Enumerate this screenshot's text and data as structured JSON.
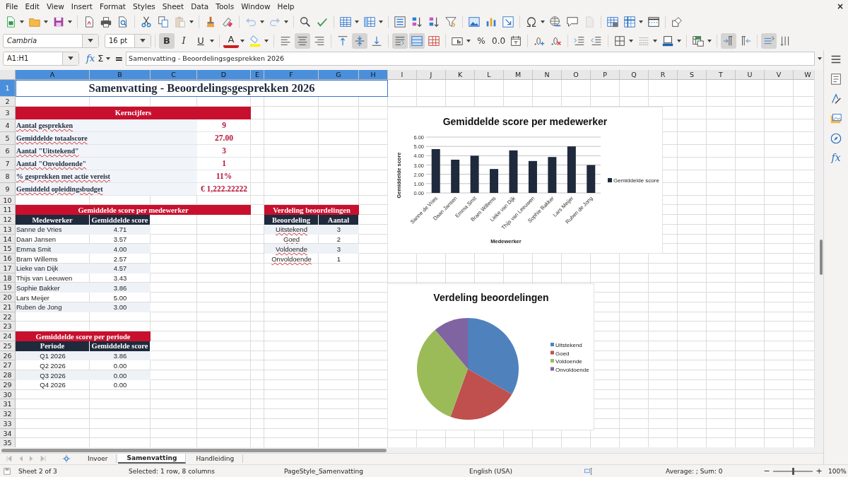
{
  "menu": [
    "File",
    "Edit",
    "View",
    "Insert",
    "Format",
    "Styles",
    "Sheet",
    "Data",
    "Tools",
    "Window",
    "Help"
  ],
  "close_symbol": "×",
  "standard_toolbar": {
    "disabled": {
      "paste": true,
      "undo": true,
      "redo": true,
      "header_footer": true
    }
  },
  "format_toolbar": {
    "font_name": "Cambria",
    "font_size": "16 pt",
    "bold_label": "B",
    "italic_label": "I",
    "underline_label": "U",
    "font_color_label": "A",
    "percent_label": "%",
    "decimal_label": "0.0",
    "toggles": {
      "bold": true,
      "italic": false,
      "underline": false,
      "align_left": false,
      "align_center": true,
      "align_right": false,
      "align_top": false,
      "align_middle": true,
      "align_bottom": false,
      "wrap_text": true,
      "merge_center": true,
      "unmerge": false,
      "left_to_right": true,
      "right_to_left": false,
      "vertical_text": true,
      "stacked": false
    }
  },
  "formula_bar": {
    "name_box": "A1:H1",
    "function_wizard": "fx",
    "sum": "Σ",
    "equals": "=",
    "content": "Samenvatting - Beoordelingsgesprekken 2026"
  },
  "sheet": {
    "column_headers": [
      {
        "label": "A",
        "selected": true
      },
      {
        "label": "B",
        "selected": true
      },
      {
        "label": "C",
        "selected": true
      },
      {
        "label": "D",
        "selected": true
      },
      {
        "label": "E",
        "selected": true
      },
      {
        "label": "F",
        "selected": true
      },
      {
        "label": "G",
        "selected": true
      },
      {
        "label": "H",
        "selected": true
      },
      {
        "label": "I",
        "selected": false
      },
      {
        "label": "J",
        "selected": false
      },
      {
        "label": "K",
        "selected": false
      },
      {
        "label": "L",
        "selected": false
      },
      {
        "label": "M",
        "selected": false
      },
      {
        "label": "N",
        "selected": false
      },
      {
        "label": "O",
        "selected": false
      },
      {
        "label": "P",
        "selected": false
      },
      {
        "label": "Q",
        "selected": false
      },
      {
        "label": "R",
        "selected": false
      },
      {
        "label": "S",
        "selected": false
      },
      {
        "label": "T",
        "selected": false
      },
      {
        "label": "U",
        "selected": false
      },
      {
        "label": "V",
        "selected": false
      },
      {
        "label": "W",
        "selected": false
      }
    ],
    "row_headers": [
      {
        "label": "1",
        "selected": true
      },
      {
        "label": "2",
        "selected": false
      },
      {
        "label": "3",
        "selected": false
      },
      {
        "label": "4",
        "selected": false
      },
      {
        "label": "5",
        "selected": false
      },
      {
        "label": "6",
        "selected": false
      },
      {
        "label": "7",
        "selected": false
      },
      {
        "label": "8",
        "selected": false
      },
      {
        "label": "9",
        "selected": false
      },
      {
        "label": "10",
        "selected": false
      },
      {
        "label": "11",
        "selected": false
      },
      {
        "label": "12",
        "selected": false
      },
      {
        "label": "13",
        "selected": false
      },
      {
        "label": "14",
        "selected": false
      },
      {
        "label": "15",
        "selected": false
      },
      {
        "label": "16",
        "selected": false
      },
      {
        "label": "17",
        "selected": false
      },
      {
        "label": "18",
        "selected": false
      },
      {
        "label": "19",
        "selected": false
      },
      {
        "label": "20",
        "selected": false
      },
      {
        "label": "21",
        "selected": false
      },
      {
        "label": "22",
        "selected": false
      },
      {
        "label": "23",
        "selected": false
      },
      {
        "label": "24",
        "selected": false
      },
      {
        "label": "25",
        "selected": false
      },
      {
        "label": "26",
        "selected": false
      },
      {
        "label": "27",
        "selected": false
      },
      {
        "label": "28",
        "selected": false
      },
      {
        "label": "29",
        "selected": false
      },
      {
        "label": "30",
        "selected": false
      },
      {
        "label": "31",
        "selected": false
      },
      {
        "label": "32",
        "selected": false
      },
      {
        "label": "33",
        "selected": false
      },
      {
        "label": "34",
        "selected": false
      },
      {
        "label": "35",
        "selected": false
      }
    ],
    "title": "Samenvatting - Beoordelingsgesprekken 2026",
    "key_figures": {
      "title": "Kerncijfers",
      "rows": [
        {
          "label": "Aantal gesprekken",
          "value": "9",
          "misspelled": true
        },
        {
          "label": "Gemiddelde totaalscore",
          "value": "27.00",
          "misspelled": true
        },
        {
          "label": "Aantal \"Uitstekend\"",
          "value": "3",
          "misspelled": true
        },
        {
          "label": "Aantal \"Onvoldoende\"",
          "value": "1",
          "misspelled": true
        },
        {
          "label": "% gesprekken met actie vereist",
          "value": "11%",
          "misspelled": true
        },
        {
          "label": "Gemiddeld opleidingsbudget",
          "value": "€ 1,222.22222",
          "misspelled": true
        }
      ]
    },
    "employee_table": {
      "title": "Gemiddelde score per medewerker",
      "columns": [
        "Medewerker",
        "Gemiddelde score"
      ],
      "rows": [
        [
          "Sanne de Vries",
          "4.71"
        ],
        [
          "Daan Jansen",
          "3.57"
        ],
        [
          "Emma Smit",
          "4.00"
        ],
        [
          "Bram Willems",
          "2.57"
        ],
        [
          "Lieke van Dijk",
          "4.57"
        ],
        [
          "Thijs van Leeuwen",
          "3.43"
        ],
        [
          "Sophie Bakker",
          "3.86"
        ],
        [
          "Lars Meijer",
          "5.00"
        ],
        [
          "Ruben de Jong",
          "3.00"
        ]
      ]
    },
    "rating_table": {
      "title": "Verdeling beoordelingen",
      "columns": [
        "Beoordeling",
        "Aantal"
      ],
      "rows": [
        {
          "label": "Uitstekend",
          "count": "3",
          "misspelled": true
        },
        {
          "label": "Goed",
          "count": "2",
          "misspelled": true
        },
        {
          "label": "Voldoende",
          "count": "3",
          "misspelled": true
        },
        {
          "label": "Onvoldoende",
          "count": "1",
          "misspelled": true
        }
      ]
    },
    "period_table": {
      "title": "Gemiddelde score per periode",
      "columns": [
        "Periode",
        "Gemiddelde score"
      ],
      "rows": [
        [
          "Q1 2026",
          "3.86"
        ],
        [
          "Q2 2026",
          "0.00"
        ],
        [
          "Q3 2026",
          "0.00"
        ],
        [
          "Q4 2026",
          "0.00"
        ]
      ]
    }
  },
  "charts": [
    {
      "chart_data": {
        "type": "bar",
        "title": "Gemiddelde score per medewerker",
        "xlabel": "Medewerker",
        "ylabel": "Gemiddelde score",
        "categories": [
          "Sanne de Vries",
          "Daan Jansen",
          "Emma Smit",
          "Bram Willems",
          "Lieke van Dijk",
          "Thijs van Leeuwen",
          "Sophie Bakker",
          "Lars Meijer",
          "Ruben de Jong"
        ],
        "series": [
          {
            "name": "Gemiddelde score",
            "color": "#1f2a3c",
            "values": [
              4.71,
              3.57,
              4.0,
              2.57,
              4.57,
              3.43,
              3.86,
              5.0,
              3.0
            ]
          }
        ],
        "grid": true,
        "legend": true,
        "ylim": [
          0,
          6
        ],
        "yticks": [
          {
            "value": 0,
            "label": "0.00"
          },
          {
            "value": 1,
            "label": "1.00"
          },
          {
            "value": 2,
            "label": "2.00"
          },
          {
            "value": 3,
            "label": "3.00"
          },
          {
            "value": 4,
            "label": "4.00"
          },
          {
            "value": 5,
            "label": "5.00"
          },
          {
            "value": 6,
            "label": "6.00"
          }
        ]
      }
    },
    {
      "chart_data": {
        "type": "pie",
        "title": "Verdeling beoordelingen",
        "categories": [
          "Uitstekend",
          "Goed",
          "Voldoende",
          "Onvoldoende"
        ],
        "legend": true,
        "series": [
          {
            "colors": [
              "#4f81bd",
              "#c0504d",
              "#9bbb59",
              "#8064a2"
            ],
            "values": [
              33.33,
              22.22,
              33.33,
              11.12
            ]
          }
        ]
      }
    }
  ],
  "sheet_tabs": [
    {
      "label": "Invoer",
      "selected": false
    },
    {
      "label": "Samenvatting",
      "selected": true
    },
    {
      "label": "Handleiding",
      "selected": false
    }
  ],
  "sidebar": {
    "functions_label": "fx"
  },
  "status_bar": {
    "sheet": "Sheet 2 of 3",
    "selection": "Selected: 1 row, 8 columns",
    "page_style": "PageStyle_Samenvatting",
    "language": "English (USA)",
    "summary": "Average: ; Sum: 0",
    "zoom_out": "−",
    "zoom_in": "+",
    "zoom": "100%",
    "zoom_slider": {
      "level": 0.5
    }
  }
}
